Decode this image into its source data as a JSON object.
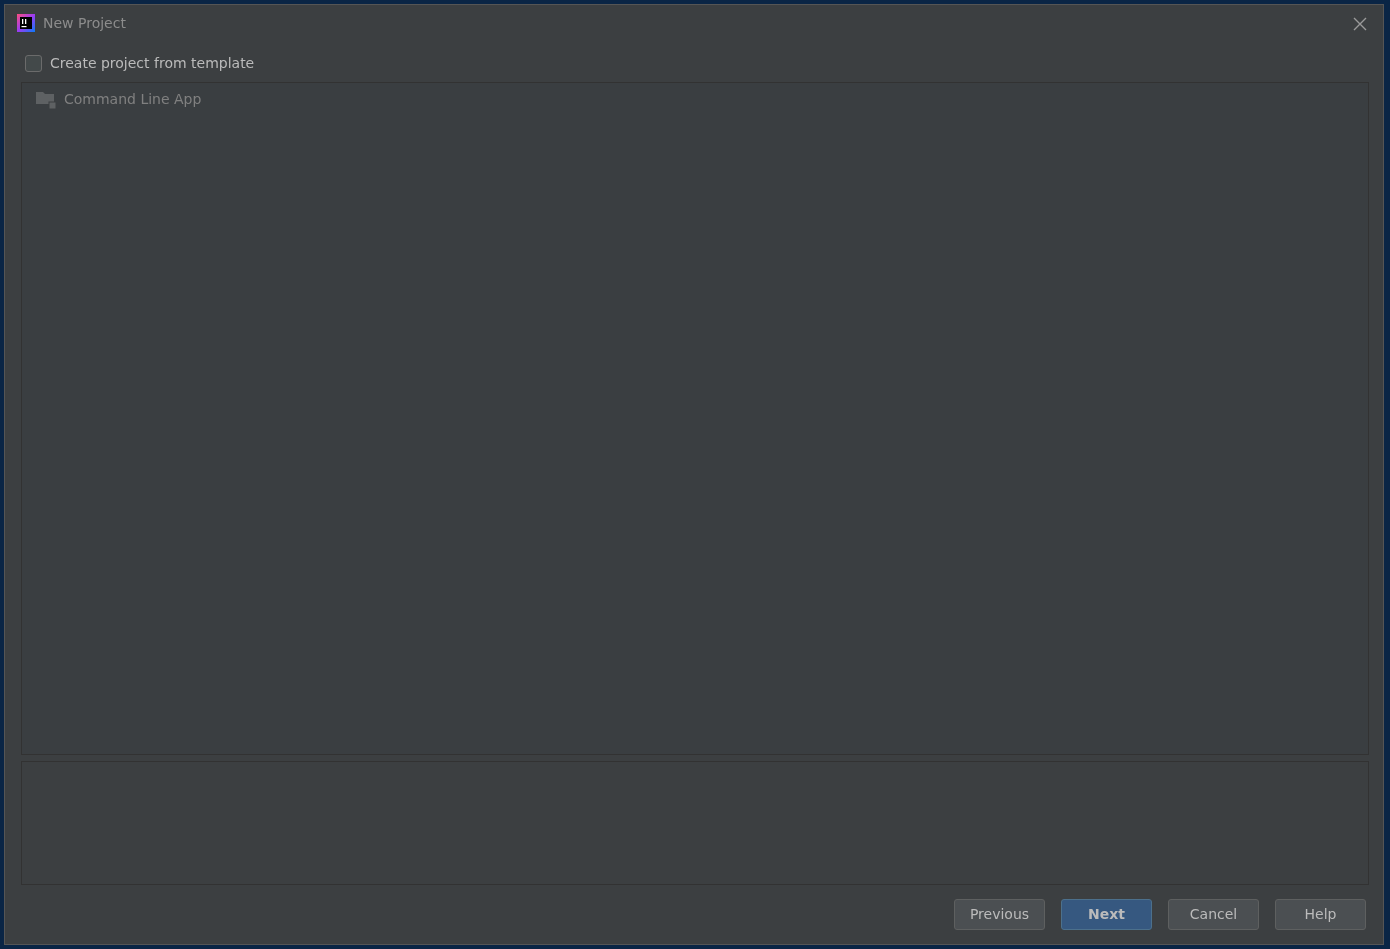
{
  "window": {
    "title": "New Project"
  },
  "template_checkbox": {
    "label": "Create project from template",
    "checked": false
  },
  "templates": [
    {
      "label": "Command Line App",
      "disabled": true
    }
  ],
  "buttons": [
    {
      "label": "Previous",
      "default": false
    },
    {
      "label": "Next",
      "default": true
    },
    {
      "label": "Cancel",
      "default": false
    },
    {
      "label": "Help",
      "default": false
    }
  ]
}
